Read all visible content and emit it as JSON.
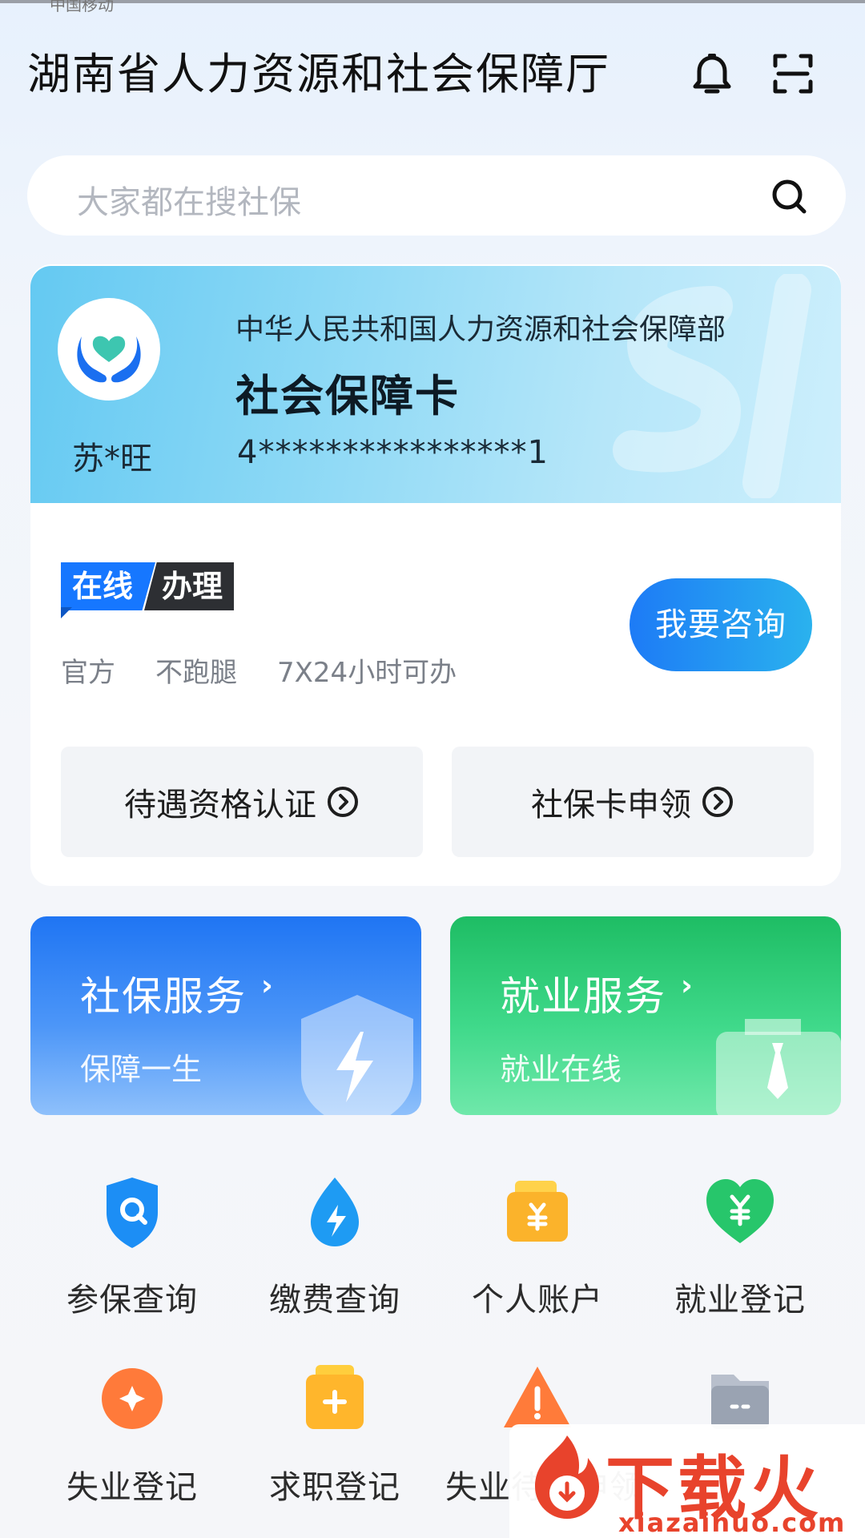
{
  "status_bar": {
    "text": "中国移动"
  },
  "header": {
    "title": "湖南省人力资源和社会保障厅",
    "icons": [
      "bell-icon",
      "scan-icon"
    ]
  },
  "search": {
    "placeholder": "大家都在搜社保",
    "icon": "search-icon"
  },
  "card": {
    "holder_name": "苏*旺",
    "ministry": "中华人民共和国人力资源和社会保障部",
    "title": "社会保障卡",
    "number": "4****************1",
    "logo": "heart-hands-logo"
  },
  "online": {
    "badge_left": "在线",
    "badge_right": "办理",
    "tags": [
      "官方",
      "不跑腿",
      "7X24小时可办"
    ],
    "consult_button": "我要咨询"
  },
  "quick_actions": [
    {
      "label": "待遇资格认证",
      "icon": "circle-chevron-right-icon"
    },
    {
      "label": "社保卡申领",
      "icon": "circle-chevron-right-icon"
    }
  ],
  "services": [
    {
      "title": "社保服务",
      "subtitle": "保障一生",
      "arrow": "›",
      "color": "#1f75f3",
      "icon": "shield-bolt-icon"
    },
    {
      "title": "就业服务",
      "subtitle": "就业在线",
      "arrow": "›",
      "color": "#1ebd64",
      "icon": "briefcase-tie-icon"
    }
  ],
  "grid": [
    {
      "label": "参保查询",
      "icon": "shield-search-icon"
    },
    {
      "label": "缴费查询",
      "icon": "water-drop-bolt-icon"
    },
    {
      "label": "个人账户",
      "icon": "wallet-yuan-icon"
    },
    {
      "label": "就业登记",
      "icon": "heart-yuan-icon"
    },
    {
      "label": "失业登记",
      "icon": "orange-badge-icon"
    },
    {
      "label": "求职登记",
      "icon": "folder-plus-icon"
    },
    {
      "label": "失业待遇申领",
      "icon": "warning-triangle-icon"
    },
    {
      "label": "",
      "icon": "grey-folder-icon"
    }
  ],
  "watermark": {
    "title": "下载火",
    "url": "xiazaihuo.com"
  }
}
